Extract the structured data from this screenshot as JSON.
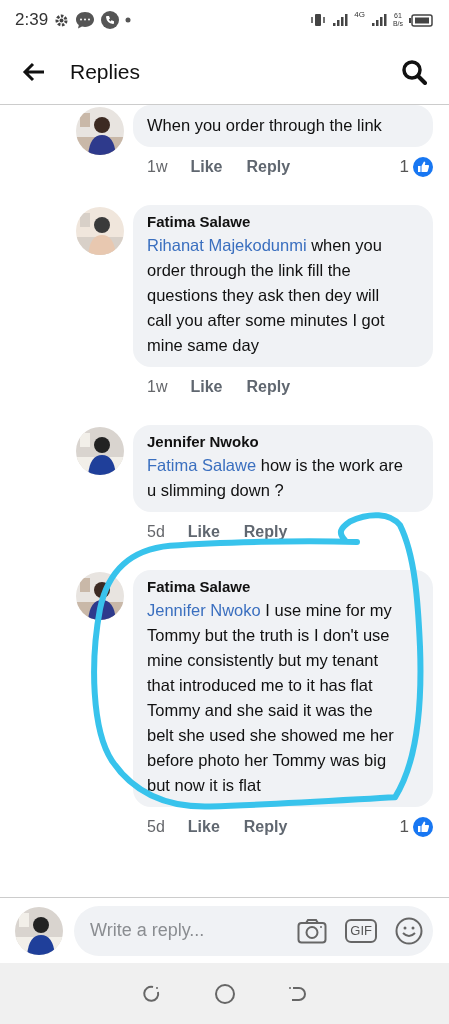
{
  "status_bar": {
    "time": "2:39",
    "network": "4G",
    "speed_value": "61",
    "speed_unit": "B/s"
  },
  "header": {
    "title": "Replies"
  },
  "comments": [
    {
      "text": "When you order through the link",
      "time": "1w",
      "like": "Like",
      "reply": "Reply",
      "reactions": "1"
    },
    {
      "author": "Fatima Salawe",
      "mention": "Rihanat Majekodunmi",
      "text": "when you order through the link fill the questions they ask then dey will call you after some minutes I got mine same day",
      "time": "1w",
      "like": "Like",
      "reply": "Reply"
    },
    {
      "author": "Jennifer Nwoko",
      "mention": "Fatima Salawe",
      "text": "how is the work are u slimming down ?",
      "time": "5d",
      "like": "Like",
      "reply": "Reply"
    },
    {
      "author": "Fatima Salawe",
      "mention": "Jennifer Nwoko",
      "text": "I use mine for my Tommy but the truth is I don't use mine consistently but my tenant that introduced me to it has flat Tommy and she said it was the belt she used she showed me her before photo her Tommy was big but now it is flat",
      "time": "5d",
      "like": "Like",
      "reply": "Reply",
      "reactions": "1",
      "annotated": true
    }
  ],
  "composer": {
    "placeholder": "Write a reply...",
    "gif_label": "GIF"
  },
  "annotation": {
    "color": "#38c3ec"
  }
}
